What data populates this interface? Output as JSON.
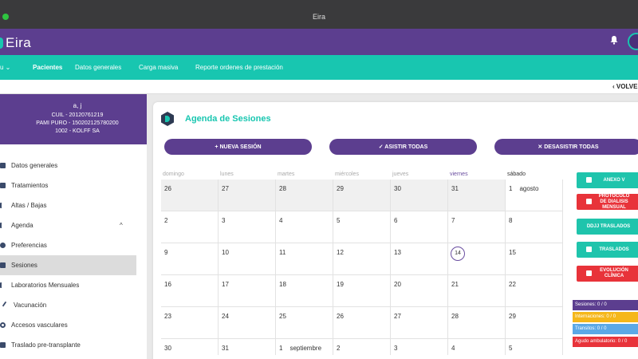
{
  "window": {
    "title": "Eira"
  },
  "app": {
    "logo_text": "Eira"
  },
  "nav": {
    "items": [
      {
        "label": "u ⌄",
        "active": false
      },
      {
        "label": "Pacientes",
        "active": true
      },
      {
        "label": "Datos generales",
        "active": false
      },
      {
        "label": "Carga masiva",
        "active": false
      },
      {
        "label": "Reporte ordenes de prestación",
        "active": false
      }
    ]
  },
  "back": {
    "label": "VOLVE"
  },
  "patient": {
    "name": "a, j",
    "cuil": "CUIL - 20120761219",
    "pami": "PAMI PURO - 150202125780200",
    "center": "1002 - KOLFF SA"
  },
  "sidebar": {
    "items": [
      {
        "label": "Datos generales"
      },
      {
        "label": "Tratamientos"
      },
      {
        "label": "Altas / Bajas"
      },
      {
        "label": "Agenda",
        "chevron": "^"
      },
      {
        "label": "Preferencias"
      },
      {
        "label": "Sesiones",
        "active": true
      },
      {
        "label": "Laboratorios Mensuales"
      },
      {
        "label": "Vacunación"
      },
      {
        "label": "Accesos vasculares"
      },
      {
        "label": "Traslado pre-transplante"
      }
    ]
  },
  "agenda": {
    "title": "Agenda de Sesiones",
    "buttons": {
      "new": "+ NUEVA SESIÓN",
      "attend": "✓ ASISTIR TODAS",
      "unattend": "✕ DESASISTIR TODAS"
    },
    "weekdays": [
      "domingo",
      "lunes",
      "martes",
      "miércoles",
      "jueves",
      "viernes",
      "sábado"
    ],
    "weeks": [
      [
        "26",
        "27",
        "28",
        "29",
        "30",
        "31",
        "1"
      ],
      [
        "2",
        "3",
        "4",
        "5",
        "6",
        "7",
        "8"
      ],
      [
        "9",
        "10",
        "11",
        "12",
        "13",
        "14",
        "15"
      ],
      [
        "16",
        "17",
        "18",
        "19",
        "20",
        "21",
        "22"
      ],
      [
        "23",
        "24",
        "25",
        "26",
        "27",
        "28",
        "29"
      ],
      [
        "30",
        "31",
        "1",
        "2",
        "3",
        "4",
        "5"
      ]
    ],
    "month_labels": {
      "agosto": "agosto",
      "septiembre": "septiembre"
    },
    "today": "14"
  },
  "right_actions": [
    {
      "label": "ANEXO V",
      "color": "#1fc4ac"
    },
    {
      "label": "PROTOCOLO DE DIALISIS MENSUAL",
      "color": "#e8333a"
    },
    {
      "label": "DDJJ TRASLADOS",
      "color": "#1fc4ac"
    },
    {
      "label": "TRASLADOS",
      "color": "#1fc4ac"
    },
    {
      "label": "EVOLUCIÓN CLÍNICA",
      "color": "#e8333a"
    }
  ],
  "legend": [
    {
      "label": "Sesiones: 0 / 0",
      "color": "#5c3e8f"
    },
    {
      "label": "Internaciones: 0 / 0",
      "color": "#f5b71a"
    },
    {
      "label": "Transitos: 0 / 0",
      "color": "#5ba8e6"
    },
    {
      "label": "Agudo ambulatorio: 0 / 0",
      "color": "#e8333a"
    }
  ],
  "colors": {
    "primary": "#5c3e8f",
    "accent": "#18c6b0",
    "danger": "#e8333a"
  }
}
